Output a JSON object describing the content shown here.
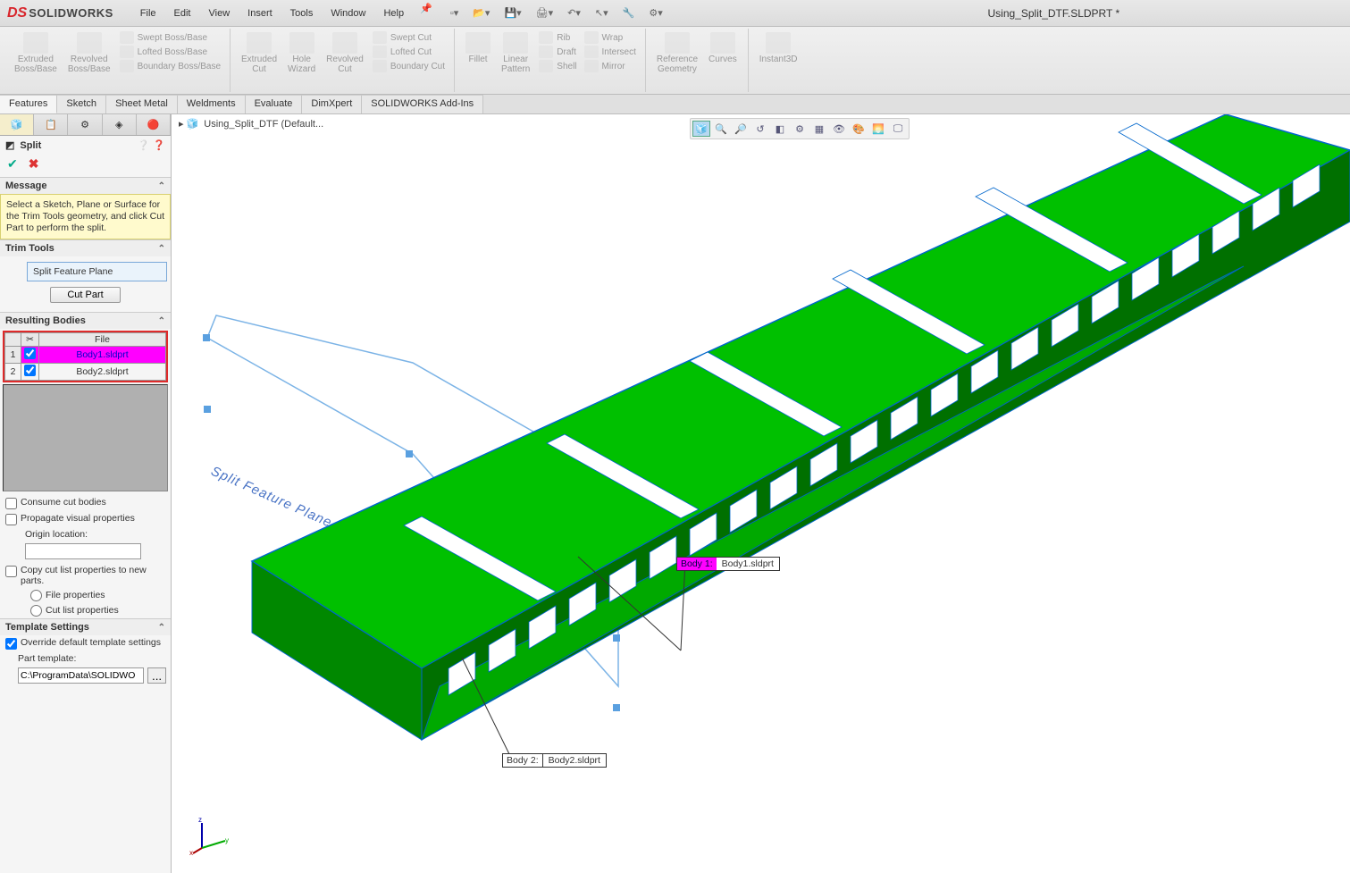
{
  "app": {
    "logo_text": "SOLIDWORKS",
    "doc_title": "Using_Split_DTF.SLDPRT *"
  },
  "menus": [
    "File",
    "Edit",
    "View",
    "Insert",
    "Tools",
    "Window",
    "Help"
  ],
  "ribbon": {
    "boss": {
      "extruded": "Extruded\nBoss/Base",
      "revolved": "Revolved\nBoss/Base",
      "swept": "Swept Boss/Base",
      "lofted": "Lofted Boss/Base",
      "boundary": "Boundary Boss/Base"
    },
    "cut": {
      "extruded": "Extruded\nCut",
      "hole": "Hole\nWizard",
      "revolved": "Revolved\nCut",
      "swept": "Swept Cut",
      "lofted": "Lofted Cut",
      "boundary": "Boundary Cut"
    },
    "feat": {
      "fillet": "Fillet",
      "linpat": "Linear\nPattern",
      "rib": "Rib",
      "draft": "Draft",
      "shell": "Shell",
      "wrap": "Wrap",
      "intersect": "Intersect",
      "mirror": "Mirror"
    },
    "ref": {
      "refgeom": "Reference\nGeometry",
      "curves": "Curves",
      "instant": "Instant3D"
    }
  },
  "cmdtabs": [
    "Features",
    "Sketch",
    "Sheet Metal",
    "Weldments",
    "Evaluate",
    "DimXpert",
    "SOLIDWORKS Add-Ins"
  ],
  "breadcrumb": "Using_Split_DTF  (Default...",
  "feature": {
    "name": "Split",
    "message_head": "Message",
    "message": "Select a Sketch, Plane or Surface for the Trim Tools geometry, and click Cut Part to perform the split.",
    "trim_head": "Trim Tools",
    "trim_sel": "Split Feature Plane",
    "cut_btn": "Cut Part",
    "rb_head": "Resulting Bodies",
    "rb_file_hdr": "File",
    "rb_rows": [
      {
        "n": "1",
        "file": "Body1.sldprt"
      },
      {
        "n": "2",
        "file": "Body2.sldprt"
      }
    ],
    "consume": "Consume cut bodies",
    "propagate": "Propagate visual properties",
    "origin_label": "Origin location:",
    "origin_value": "",
    "copy_cut": "Copy cut list  properties to new parts.",
    "file_props": "File properties",
    "cutlist_props": "Cut list properties",
    "tmpl_head": "Template Settings",
    "override": "Override default template settings",
    "part_tmpl_label": "Part template:",
    "part_tmpl_value": "C:\\ProgramData\\SOLIDWO",
    "browse": "..."
  },
  "callouts": {
    "b1_tag": "Body  1:",
    "b1_file": "Body1.sldprt",
    "b2_tag": "Body  2:",
    "b2_file": "Body2.sldprt",
    "split_plane": "Split Feature Plane"
  }
}
